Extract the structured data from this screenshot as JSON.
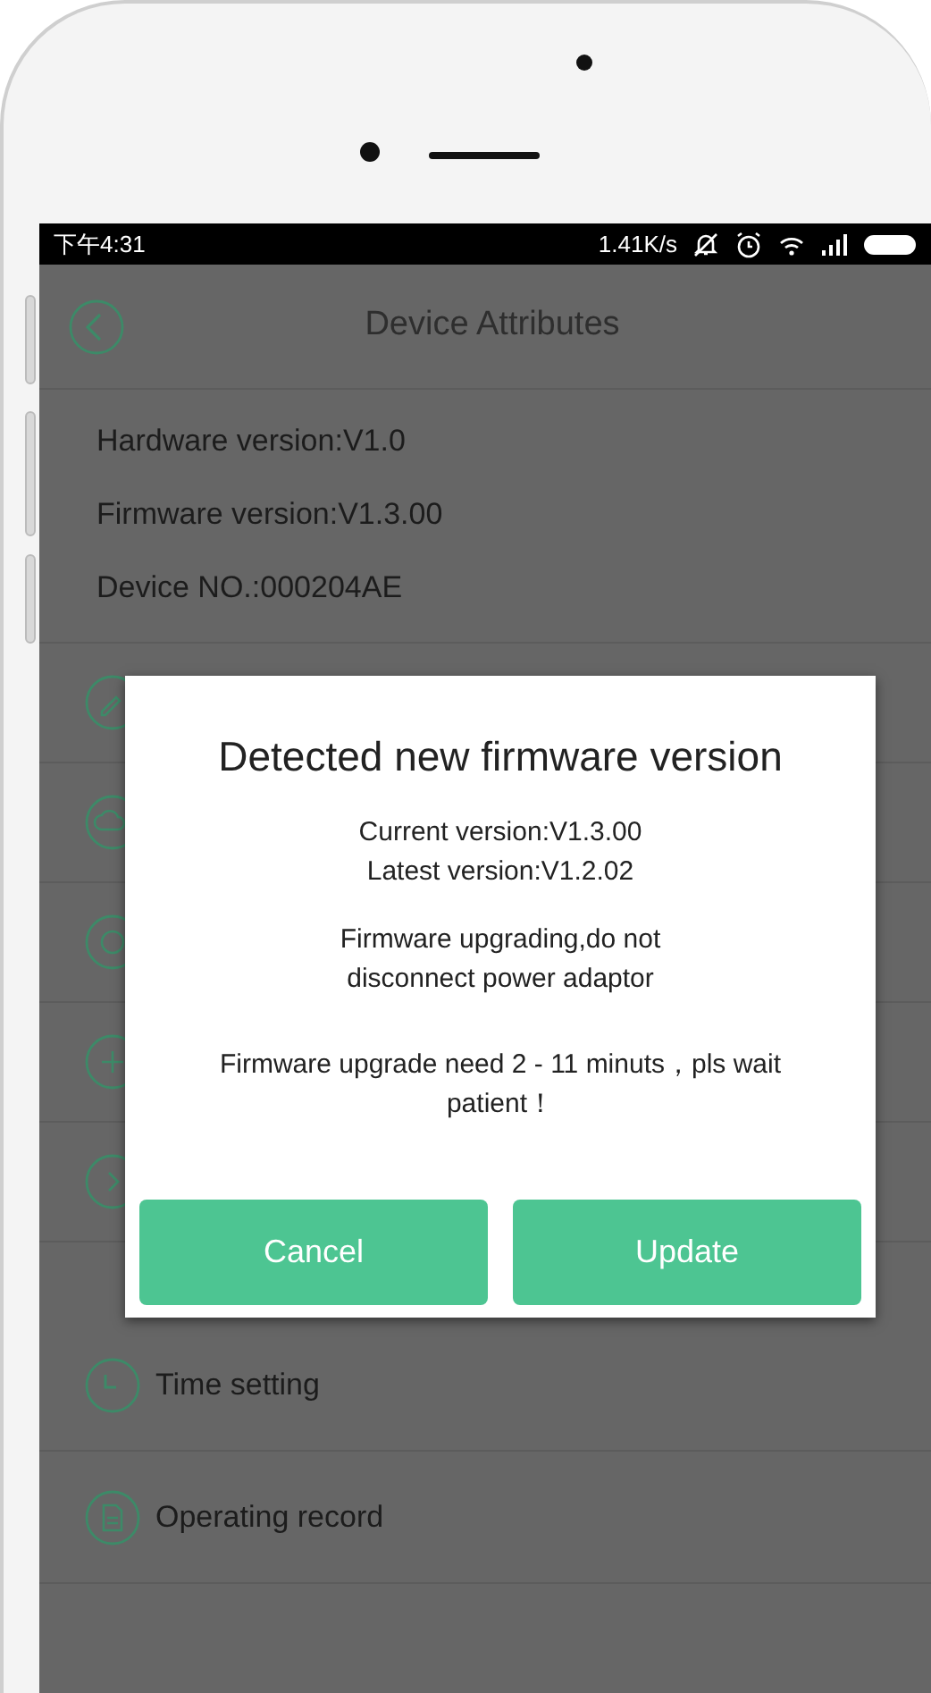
{
  "status_bar": {
    "time": "下午4:31",
    "speed": "1.41K/s"
  },
  "header": {
    "title": "Device Attributes"
  },
  "info": [
    "Hardware version:V1.0",
    "Firmware version:V1.3.00",
    "Device NO.:000204AE"
  ],
  "menu_items": [
    {
      "kind": "time",
      "label": "Time setting"
    },
    {
      "kind": "record",
      "label": "Operating record"
    }
  ],
  "dialog": {
    "title": "Detected new firmware version",
    "versions": [
      "Current version:V1.3.00",
      "Latest version:V1.2.02"
    ],
    "warning": "Firmware upgrading,do not disconnect power adaptor",
    "note": "Firmware upgrade need 2 - 11 minuts，pls wait patient！",
    "buttons": [
      "Cancel",
      "Update"
    ]
  }
}
